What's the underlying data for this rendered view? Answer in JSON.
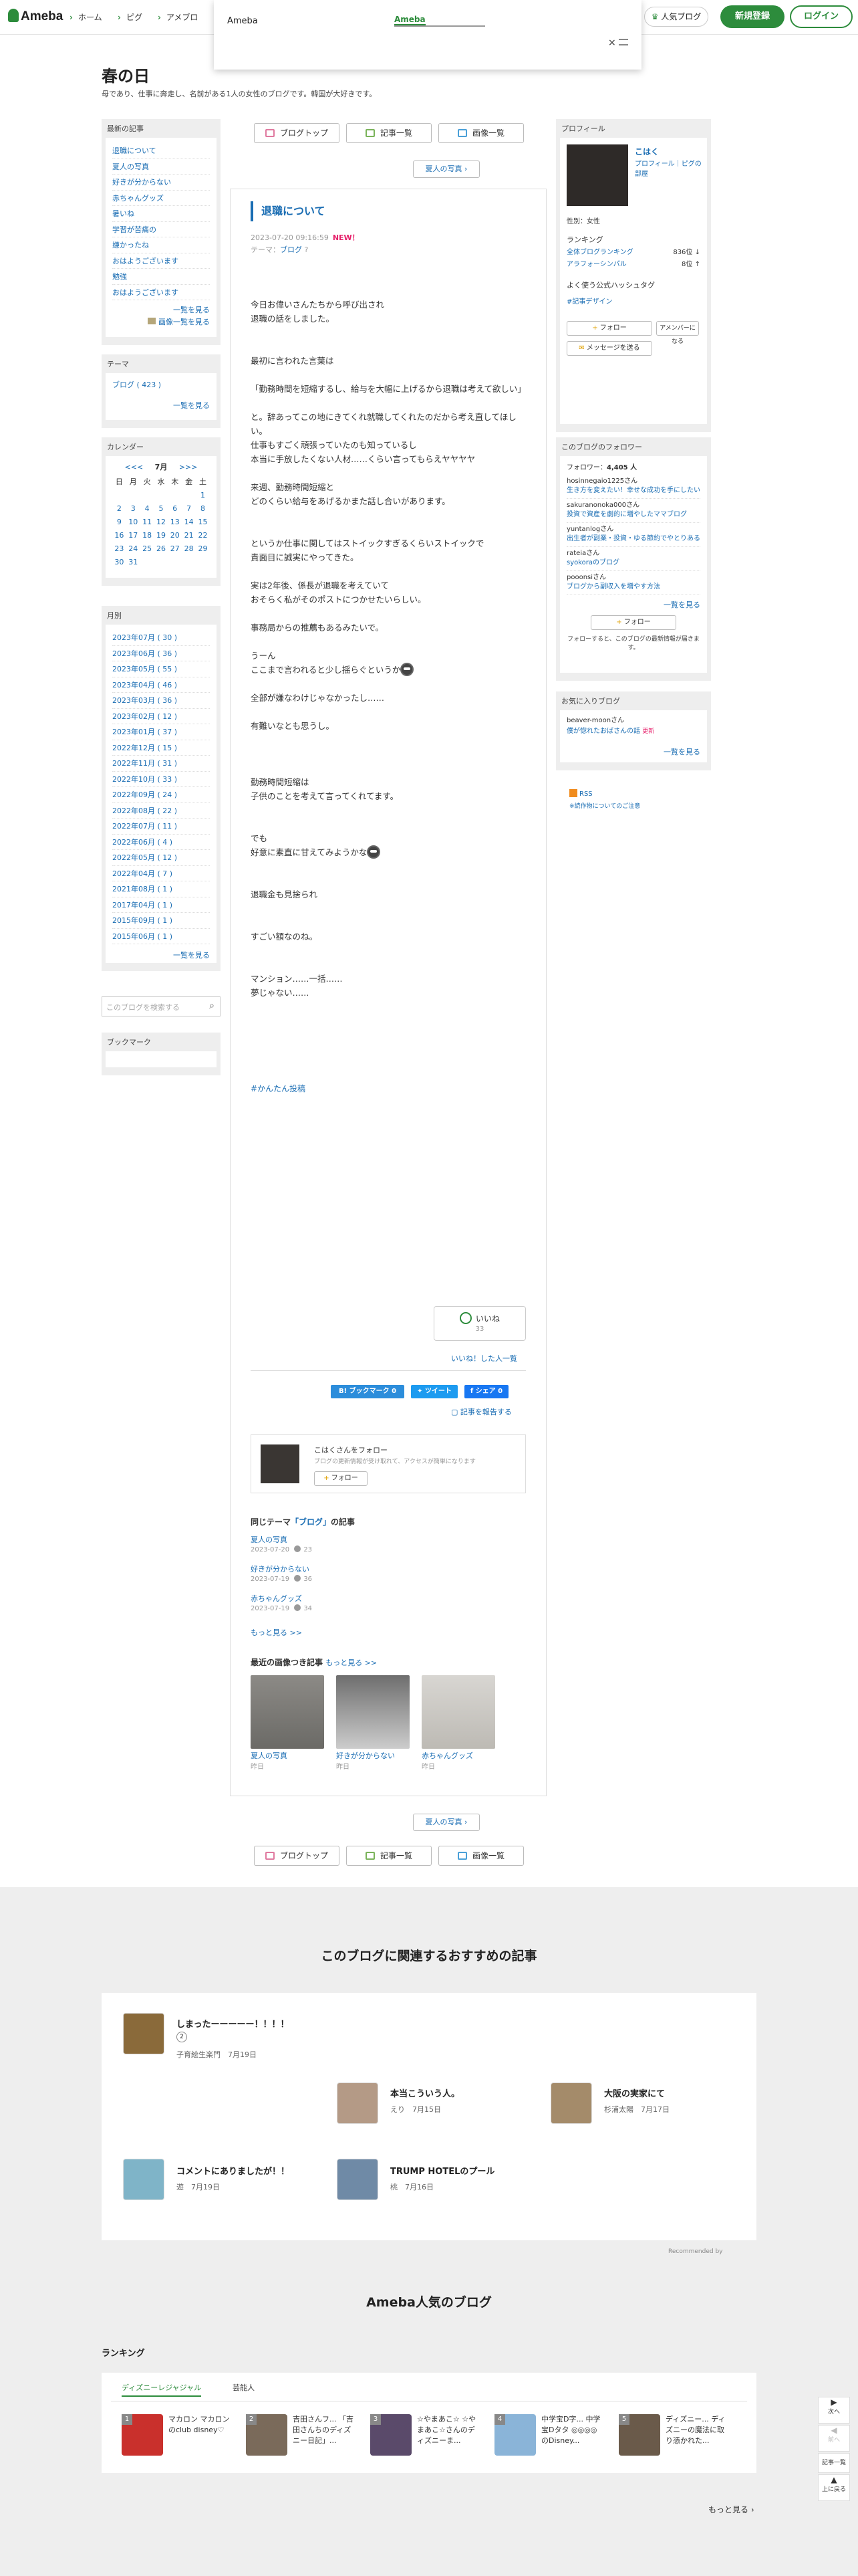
{
  "header": {
    "logo": "Ameba",
    "nav": [
      "ホーム",
      "ピグ",
      "アメブロ"
    ],
    "popular_blog": "人気ブログ",
    "register": "新規登録",
    "login": "ログイン"
  },
  "search_dropdown": {
    "scope": "Ameba",
    "query": "Ameba",
    "close": "×"
  },
  "blog": {
    "title": "春の日",
    "description": "母であり、仕事に奔走し、名前がある1人の女性のブログです。韓国が大好きです。"
  },
  "latest": {
    "heading": "最新の記事",
    "items": [
      "退職について",
      "夏人の写真",
      "好きが分からない",
      "赤ちゃんグッズ",
      "暑いね",
      "学習が苦痛の",
      "嫌かったね",
      "おはようございます",
      "勉強",
      "おはようございます"
    ],
    "more": "一覧を見る",
    "images_more": "画像一覧を見る"
  },
  "theme": {
    "heading": "テーマ",
    "item": "ブログ ( 423 )",
    "more": "一覧を見る"
  },
  "calendar": {
    "heading": "カレンダー",
    "prev": "<<<",
    "month": "7月",
    "next": ">>>",
    "weekdays": [
      "日",
      "月",
      "火",
      "水",
      "木",
      "金",
      "土"
    ],
    "weeks": [
      [
        "",
        "",
        "",
        "",
        "",
        "",
        "1"
      ],
      [
        "2",
        "3",
        "4",
        "5",
        "6",
        "7",
        "8"
      ],
      [
        "9",
        "10",
        "11",
        "12",
        "13",
        "14",
        "15"
      ],
      [
        "16",
        "17",
        "18",
        "19",
        "20",
        "21",
        "22"
      ],
      [
        "23",
        "24",
        "25",
        "26",
        "27",
        "28",
        "29"
      ],
      [
        "30",
        "31",
        "",
        "",
        "",
        "",
        ""
      ]
    ]
  },
  "monthly": {
    "heading": "月別",
    "items": [
      "2023年07月 ( 30 )",
      "2023年06月 ( 36 )",
      "2023年05月 ( 55 )",
      "2023年04月 ( 46 )",
      "2023年03月 ( 36 )",
      "2023年02月 ( 12 )",
      "2023年01月 ( 37 )",
      "2022年12月 ( 15 )",
      "2022年11月 ( 31 )",
      "2022年10月 ( 33 )",
      "2022年09月 ( 24 )",
      "2022年08月 ( 22 )",
      "2022年07月 ( 11 )",
      "2022年06月 ( 4 )",
      "2022年05月 ( 12 )",
      "2022年04月 ( 7 )",
      "2021年08月 ( 1 )",
      "2017年04月 ( 1 )",
      "2015年09月 ( 1 )",
      "2015年06月 ( 1 )"
    ],
    "more": "一覧を見る"
  },
  "blog_search_placeholder": "このブログを検索する",
  "bookmark": {
    "heading": "ブックマーク"
  },
  "topnav": {
    "top": "ブログトップ",
    "list": "記事一覧",
    "images": "画像一覧",
    "next": "夏人の写真"
  },
  "article": {
    "title": "退職について",
    "date": "2023-07-20 09:16:59",
    "new": "NEW！",
    "theme_label": "テーマ：",
    "theme": "ブログ",
    "body": [
      "今日お偉いさんたちから呼び出され",
      "退職の話をしました。",
      "",
      "",
      "最初に言われた言葉は",
      "",
      "「勤務時間を短縮するし、給与を大幅に上げるから退職は考えて欲しい」",
      "",
      "と。辞あってこの地にきてくれ就職してくれたのだから考え直してほしい。",
      "仕事もすごく頑張っていたのも知っているし",
      "本当に手放したくない人材……くらい言ってもらえヤヤヤヤ",
      "",
      "来週、勤務時間短縮と",
      "どのくらい給与をあげるかまた話し合いがあります。",
      "",
      "",
      "というか仕事に関してはストイックすぎるくらいストイックで",
      "責面目に誠実にやってきた。",
      "",
      "実は2年後、係長が退職を考えていて",
      "おそらく私がそのポストにつかせたいらしい。",
      "",
      "事務局からの推薦もあるみたいで。",
      "",
      "うーん",
      "ここまで言われると少し揺らぐというか",
      "",
      "全部が嫌なわけじゃなかったし……",
      "",
      "有難いなとも思うし。",
      "",
      "",
      "",
      "勤務時間短縮は",
      "子供のことを考えて言ってくれてます。",
      "",
      "",
      "でも",
      "好意に素直に甘えてみようかな",
      "",
      "",
      "退職金も見捨られ",
      "",
      "",
      "すごい額なのね。",
      "",
      "",
      "マンション……一括……",
      "夢じゃない……"
    ],
    "hashtag": "#かんたん投稿",
    "like": "いいね",
    "like_count": "33",
    "like_list": "いいね！した人一覧",
    "share": {
      "hatena": "B! ブックマーク",
      "hatena_count": "0",
      "twitter": "ツイート",
      "facebook": "シェア",
      "facebook_count": "0"
    },
    "report": "記事を報告する",
    "follow_name": "こはくさんをフォロー",
    "follow_desc": "ブログの更新情報が受け取れて、アクセスが簡単になります",
    "follow_btn": "フォロー"
  },
  "same_theme": {
    "heading_pre": "同じテーマ",
    "heading_theme": "「ブログ」",
    "heading_post": "の記事",
    "items": [
      {
        "title": "夏人の写真",
        "date": "2023-07-20",
        "count": "23"
      },
      {
        "title": "好きが分からない",
        "date": "2023-07-19",
        "count": "36"
      },
      {
        "title": "赤ちゃんグッズ",
        "date": "2023-07-19",
        "count": "34"
      }
    ],
    "more": "もっと見る >>"
  },
  "recent_images": {
    "heading": "最近の画像つき記事",
    "more": "もっと見る >>",
    "items": [
      {
        "title": "夏人の写真",
        "when": "昨日"
      },
      {
        "title": "好きが分からない",
        "when": "昨日"
      },
      {
        "title": "赤ちゃんグッズ",
        "when": "昨日"
      }
    ]
  },
  "profile": {
    "heading": "プロフィール",
    "name": "こはく",
    "links": "プロフィール｜ピグの部屋",
    "gender_label": "性別：",
    "gender": "女性",
    "ranking_label": "ランキング",
    "overall_label": "全体ブログランキング",
    "overall_rank": "836位",
    "genre_label": "アラフォーシンパル",
    "genre_rank": "8位",
    "hashtag_label": "よく使う公式ハッシュタグ",
    "hashtag": "#記事デザイン",
    "follow": "フォロー",
    "amember": "アメンバーになる",
    "message": "メッセージを送る"
  },
  "followers": {
    "heading": "このブログのフォロワー",
    "count_label": "フォロワー：",
    "count": "4,405 人",
    "items": [
      {
        "name": "hosinnegaio1225さん",
        "post": "生き方を変えたい！幸せな成功を手にしたい..."
      },
      {
        "name": "sakuranonoka000さん",
        "post": "投資で資産を劇的に増やしたママブログ"
      },
      {
        "name": "yuntanlogさん",
        "post": "出生者が副業・投資・ゆる節約でやとりある..."
      },
      {
        "name": "rateiaさん",
        "post": "syokoraのブログ"
      },
      {
        "name": "pooonsiさん",
        "post": "ブログから副収入を増やす方法"
      }
    ],
    "more": "一覧を見る",
    "follow_btn": "フォロー",
    "note": "フォローすると、このブログの最新情報が届きます。"
  },
  "favorites": {
    "heading": "お気に入りブログ",
    "name": "beaver-moonさん",
    "post": "僕が惚れたおばさんの話",
    "new": "更新",
    "more": "一覧を見る"
  },
  "rss": {
    "label": "RSS",
    "help": "※読作物についてのご注意"
  },
  "bottom_nav": {
    "next": "夏人の写真",
    "top": "ブログトップ",
    "list": "記事一覧",
    "images": "画像一覧"
  },
  "recommend": {
    "heading": "このブログに関連するおすすめの記事",
    "items": [
      {
        "title": "しまったーーーーー！！！！",
        "badge": "2",
        "author": "子育絵生楽門",
        "date": "7月19日"
      },
      {
        "title": "本当こういう人。",
        "author": "えり",
        "date": "7月15日"
      },
      {
        "title": "大阪の実家にて",
        "author": "杉浦太陽",
        "date": "7月17日"
      },
      {
        "title": "コメントにありましたが！！",
        "author": "遊",
        "date": "7月19日"
      },
      {
        "title": "TRUMP HOTELのプール",
        "author": "桃",
        "date": "7月16日"
      }
    ],
    "credit": "Recommended by"
  },
  "popular": {
    "heading": "Ameba人気のブログ",
    "ranking": "ランキング",
    "tabs": [
      "ディズニーレジャジャル",
      "芸能人"
    ],
    "items": [
      {
        "rank": "1",
        "text": "マカロン マカロンのclub disney♡"
      },
      {
        "rank": "2",
        "text": "吉田さんフ... 「吉田さんちのディズニー日記」..."
      },
      {
        "rank": "3",
        "text": "☆やまあこ☆ ☆やまあこ☆さんのディズニーま..."
      },
      {
        "rank": "4",
        "text": "中学宝D字... 中学宝Dタタ ◎◎◎◎ のDisney..."
      },
      {
        "rank": "5",
        "text": "ディズニー... ディズニーの魔法に取り憑かれた..."
      }
    ],
    "more": "もっと見る"
  },
  "side_fixed": {
    "next": "次へ",
    "prev": "前へ",
    "list": "記事一覧",
    "top": "上に戻る"
  }
}
